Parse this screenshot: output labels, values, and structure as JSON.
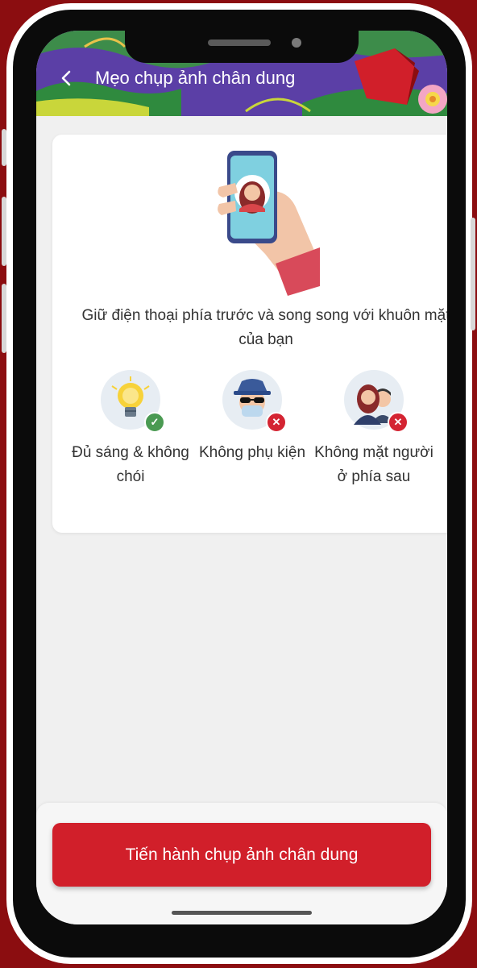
{
  "header": {
    "title": "Mẹo chụp ảnh chân dung",
    "back_icon": "chevron-left-icon"
  },
  "card": {
    "instruction": "Giữ điện thoại phía trước và song song với khuôn mặt của bạn",
    "tips": [
      {
        "label": "Đủ sáng & không chói",
        "icon": "lightbulb-icon",
        "status": "ok"
      },
      {
        "label": "Không phụ kiện",
        "icon": "accessories-icon",
        "status": "no"
      },
      {
        "label": "Không mặt người ở phía sau",
        "icon": "people-icon",
        "status": "no"
      }
    ]
  },
  "cta": {
    "label": "Tiến hành chụp ảnh chân dung"
  },
  "colors": {
    "background": "#8b0d10",
    "accent": "#d11f2a",
    "header": "#5b3fa6",
    "ok": "#4a9a52",
    "error": "#d42432"
  }
}
